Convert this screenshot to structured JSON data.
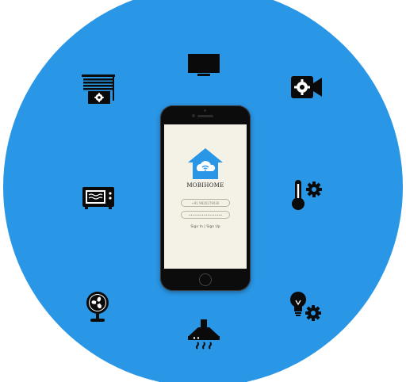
{
  "app": {
    "title": "MOBIHOME",
    "phone_placeholder": "+91 9820279036",
    "password_placeholder": "••••••••••••••••••",
    "sign_in_label": "Sign In",
    "separator": "|",
    "sign_up_label": "Sign Up"
  },
  "colors": {
    "background_circle": "#2a96e6",
    "icon": "#0a0a0a",
    "app_accent": "#2a96e6",
    "screen": "#f4f1e6"
  },
  "icons": [
    "tv-icon",
    "smart-blinds-icon",
    "security-camera-icon",
    "microwave-icon",
    "smart-thermostat-icon",
    "fan-icon",
    "smart-bulb-icon",
    "kitchen-hood-icon"
  ]
}
